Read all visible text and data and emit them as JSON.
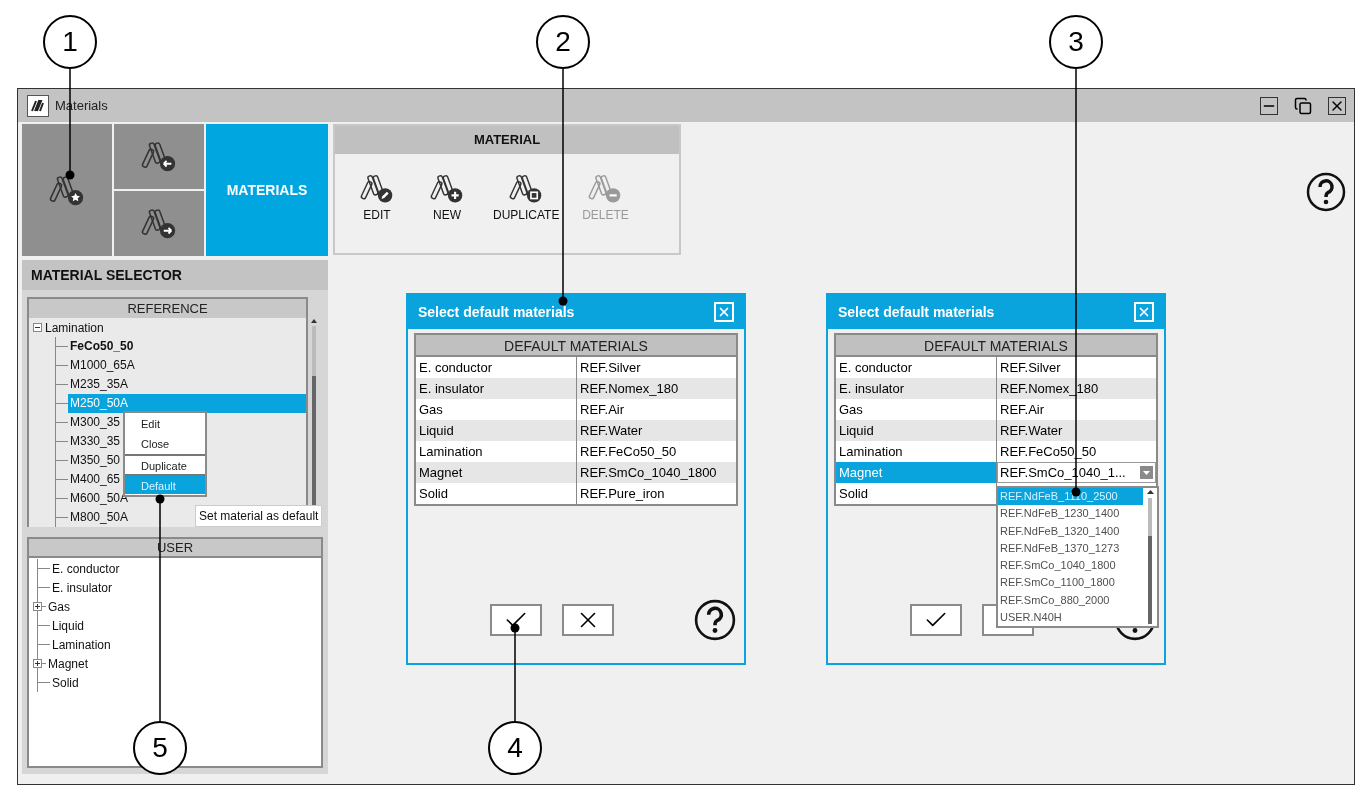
{
  "window": {
    "title": "Materials"
  },
  "nav": {
    "label": "MATERIALS",
    "selected": true
  },
  "material_toolbar": {
    "title": "MATERIAL",
    "buttons": [
      {
        "label": "EDIT",
        "kind": "edit",
        "disabled": false
      },
      {
        "label": "NEW",
        "kind": "new",
        "disabled": false
      },
      {
        "label": "DUPLICATE",
        "kind": "duplicate",
        "disabled": false
      },
      {
        "label": "DELETE",
        "kind": "delete",
        "disabled": true
      }
    ]
  },
  "material_selector": {
    "title": "MATERIAL SELECTOR",
    "reference": {
      "title": "REFERENCE",
      "items": [
        {
          "label": "Lamination",
          "expanded": true,
          "children": [
            {
              "label": "FeCo50_50",
              "is_default": true,
              "selected": false
            },
            {
              "label": "M1000_65A",
              "is_default": false,
              "selected": false
            },
            {
              "label": "M235_35A",
              "is_default": false,
              "selected": false
            },
            {
              "label": "M250_50A",
              "is_default": false,
              "selected": true
            },
            {
              "label": "M300_35",
              "is_default": false,
              "selected": false
            },
            {
              "label": "M330_35",
              "is_default": false,
              "selected": false
            },
            {
              "label": "M350_50",
              "is_default": false,
              "selected": false
            },
            {
              "label": "M400_65",
              "is_default": false,
              "selected": false
            },
            {
              "label": "M600_50A",
              "is_default": false,
              "selected": false
            },
            {
              "label": "M800_50A",
              "is_default": false,
              "selected": false
            }
          ]
        }
      ]
    },
    "user": {
      "title": "USER",
      "items": [
        {
          "label": "E. conductor",
          "kind": "leaf"
        },
        {
          "label": "E. insulator",
          "kind": "leaf"
        },
        {
          "label": "Gas",
          "kind": "group"
        },
        {
          "label": "Liquid",
          "kind": "leaf"
        },
        {
          "label": "Lamination",
          "kind": "leaf"
        },
        {
          "label": "Magnet",
          "kind": "group"
        },
        {
          "label": "Solid",
          "kind": "leaf"
        }
      ]
    }
  },
  "context_menu": {
    "items": [
      {
        "label": "Edit",
        "selected": false,
        "divider_above": false
      },
      {
        "label": "Close",
        "selected": false,
        "divider_above": false
      },
      {
        "label": "Duplicate",
        "selected": false,
        "divider_above": true
      },
      {
        "label": "Default",
        "selected": true,
        "divider_above": true
      }
    ]
  },
  "tooltip": {
    "text": "Set material as default"
  },
  "dialogs": [
    {
      "title": "Select default materials",
      "table_title": "DEFAULT MATERIALS",
      "rows": [
        {
          "category": "E. conductor",
          "value": "REF.Silver",
          "selected": false,
          "kind": "text"
        },
        {
          "category": "E. insulator",
          "value": "REF.Nomex_180",
          "selected": false,
          "kind": "text"
        },
        {
          "category": "Gas",
          "value": "REF.Air",
          "selected": false,
          "kind": "text"
        },
        {
          "category": "Liquid",
          "value": "REF.Water",
          "selected": false,
          "kind": "text"
        },
        {
          "category": "Lamination",
          "value": "REF.FeCo50_50",
          "selected": false,
          "kind": "text"
        },
        {
          "category": "Magnet",
          "value": "REF.SmCo_1040_1800",
          "selected": false,
          "kind": "text"
        },
        {
          "category": "Solid",
          "value": "REF.Pure_iron",
          "selected": false,
          "kind": "text"
        }
      ]
    },
    {
      "title": "Select default materials",
      "table_title": "DEFAULT MATERIALS",
      "rows": [
        {
          "category": "E. conductor",
          "value": "REF.Silver",
          "selected": false,
          "kind": "text"
        },
        {
          "category": "E. insulator",
          "value": "REF.Nomex_180",
          "selected": false,
          "kind": "text"
        },
        {
          "category": "Gas",
          "value": "REF.Air",
          "selected": false,
          "kind": "text"
        },
        {
          "category": "Liquid",
          "value": "REF.Water",
          "selected": false,
          "kind": "text"
        },
        {
          "category": "Lamination",
          "value": "REF.FeCo50_50",
          "selected": false,
          "kind": "text"
        },
        {
          "category": "Magnet",
          "value": "REF.SmCo_1040_1...",
          "selected": true,
          "kind": "dropdown"
        },
        {
          "category": "Solid",
          "selected": false,
          "kind": "text"
        }
      ],
      "dropdown_options": [
        {
          "label": "REF.NdFeB_1110_2500",
          "selected": true
        },
        {
          "label": "REF.NdFeB_1230_1400",
          "selected": false
        },
        {
          "label": "REF.NdFeB_1320_1400",
          "selected": false
        },
        {
          "label": "REF.NdFeB_1370_1273",
          "selected": false
        },
        {
          "label": "REF.SmCo_1040_1800",
          "selected": false
        },
        {
          "label": "REF.SmCo_1100_1800",
          "selected": false
        },
        {
          "label": "REF.SmCo_880_2000",
          "selected": false
        },
        {
          "label": "USER.N40H",
          "selected": false
        }
      ]
    }
  ],
  "callouts": [
    {
      "label": "1"
    },
    {
      "label": "2"
    },
    {
      "label": "3"
    },
    {
      "label": "4"
    },
    {
      "label": "5"
    }
  ]
}
